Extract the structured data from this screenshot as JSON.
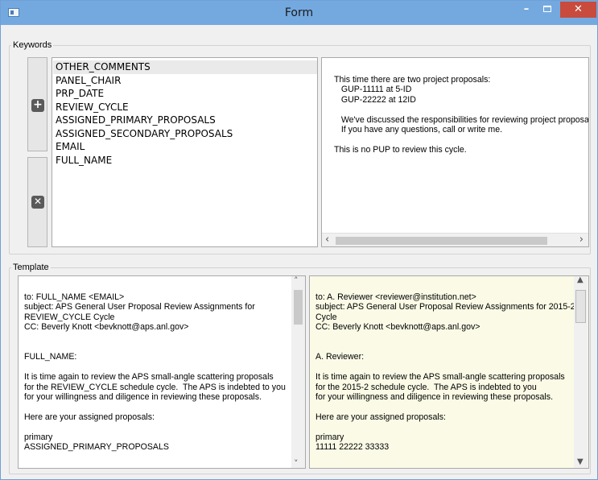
{
  "window": {
    "title": "Form"
  },
  "keywords": {
    "group_label": "Keywords",
    "items": [
      "OTHER_COMMENTS",
      "PANEL_CHAIR",
      "PRP_DATE",
      "REVIEW_CYCLE",
      "ASSIGNED_PRIMARY_PROPOSALS",
      "ASSIGNED_SECONDARY_PROPOSALS",
      "EMAIL",
      "FULL_NAME"
    ],
    "selected_index": 0,
    "add_icon": "plus-icon",
    "remove_icon": "x-icon",
    "value_text": "This time there are two project proposals:\n   GUP-11111 at 5-ID\n   GUP-22222 at 12ID\n\n   We've discussed the responsibilities for reviewing project proposal\n   If you have any questions, call or write me.\n\nThis is no PUP to review this cycle."
  },
  "template": {
    "group_label": "Template",
    "source_text": "to: FULL_NAME <EMAIL>\nsubject: APS General User Proposal Review Assignments for\nREVIEW_CYCLE Cycle\nCC: Beverly Knott <bevknott@aps.anl.gov>\n\n\nFULL_NAME:\n\nIt is time again to review the APS small-angle scattering proposals\nfor the REVIEW_CYCLE schedule cycle.  The APS is indebted to you\nfor your willingness and diligence in reviewing these proposals.\n\nHere are your assigned proposals:\n\nprimary\nASSIGNED_PRIMARY_PROPOSALS\n\n    ...",
    "preview_text": "to: A. Reviewer <reviewer@institution.net>\nsubject: APS General User Proposal Review Assignments for 2015-2\nCycle\nCC: Beverly Knott <bevknott@aps.anl.gov>\n\n\nA. Reviewer:\n\nIt is time again to review the APS small-angle scattering proposals\nfor the 2015-2 schedule cycle.  The APS is indebted to you\nfor your willingness and diligence in reviewing these proposals.\n\nHere are your assigned proposals:\n\nprimary\n11111 22222 33333\n\n    ..."
  },
  "colors": {
    "titlebar": "#74a9e0",
    "close_button": "#c84b3d",
    "preview_background": "#fafae6"
  }
}
